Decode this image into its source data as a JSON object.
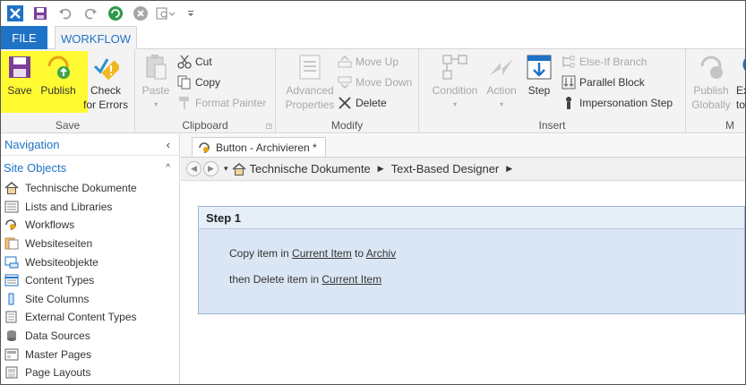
{
  "qat": {
    "icons": [
      "app-icon",
      "save-icon",
      "undo-icon",
      "redo-icon",
      "refresh-icon",
      "stop-icon",
      "view-icon",
      "customize-icon"
    ]
  },
  "tabs": {
    "file": "FILE",
    "workflow": "WORKFLOW"
  },
  "ribbon": {
    "save_group": {
      "label": "Save",
      "save": "Save",
      "publish": "Publish",
      "check_line1": "Check",
      "check_line2": "for Errors"
    },
    "clipboard_group": {
      "label": "Clipboard",
      "paste": "Paste",
      "cut": "Cut",
      "copy": "Copy",
      "format_painter": "Format Painter"
    },
    "modify_group": {
      "label": "Modify",
      "advanced_line1": "Advanced",
      "advanced_line2": "Properties",
      "move_up": "Move Up",
      "move_down": "Move Down",
      "delete": "Delete"
    },
    "insert_group": {
      "label": "Insert",
      "condition": "Condition",
      "action": "Action",
      "step": "Step",
      "else_if": "Else-If Branch",
      "parallel": "Parallel Block",
      "impersonation": "Impersonation Step"
    },
    "manage_group": {
      "label": "M",
      "publish_globally_line1": "Publish",
      "publish_globally_line2": "Globally",
      "export_line1": "Ex",
      "export_line2": "to"
    },
    "highlight_color": "#fffa32"
  },
  "nav": {
    "title": "Navigation",
    "section": "Site Objects",
    "items": [
      {
        "label": "Technische Dokumente",
        "icon": "home-icon"
      },
      {
        "label": "Lists and Libraries",
        "icon": "list-icon"
      },
      {
        "label": "Workflows",
        "icon": "workflow-icon"
      },
      {
        "label": "Websiteseiten",
        "icon": "pages-icon"
      },
      {
        "label": "Websiteobjekte",
        "icon": "assets-icon"
      },
      {
        "label": "Content Types",
        "icon": "content-types-icon"
      },
      {
        "label": "Site Columns",
        "icon": "columns-icon"
      },
      {
        "label": "External Content Types",
        "icon": "external-content-icon"
      },
      {
        "label": "Data Sources",
        "icon": "database-icon"
      },
      {
        "label": "Master Pages",
        "icon": "master-pages-icon"
      },
      {
        "label": "Page Layouts",
        "icon": "page-layouts-icon"
      }
    ]
  },
  "document": {
    "tab_title": "Button - Archivieren *",
    "breadcrumb": [
      "Technische Dokumente",
      "Text-Based Designer"
    ],
    "step": {
      "title": "Step 1",
      "line1": {
        "pre": "Copy item in ",
        "link1": "Current Item",
        "mid": " to ",
        "link2": "Archiv"
      },
      "line2": {
        "pre": "then Delete item in ",
        "link1": "Current Item"
      }
    }
  },
  "colors": {
    "accent": "#1f73c6",
    "step_bg": "#dbe6f4",
    "ribbon_bg": "#f3f3f3"
  }
}
